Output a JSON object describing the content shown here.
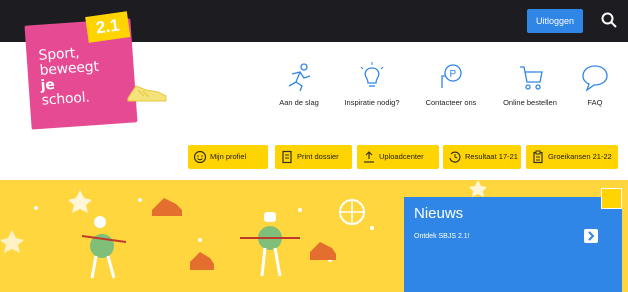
{
  "header": {
    "logout_label": "Uitloggen",
    "search_icon": "search-icon"
  },
  "logo": {
    "version": "2.1",
    "line1": "Sport,",
    "line2": "beweegt",
    "line3": "je",
    "line4": "school."
  },
  "nav": {
    "items": [
      {
        "label": "Aan de slag",
        "icon": "runner-icon"
      },
      {
        "label": "Inspiratie nodig?",
        "icon": "lightbulb-icon"
      },
      {
        "label": "Contacteer ons",
        "icon": "contact-icon"
      },
      {
        "label": "Online bestellen",
        "icon": "cart-icon"
      },
      {
        "label": "FAQ",
        "icon": "chat-icon"
      }
    ]
  },
  "actions": {
    "items": [
      {
        "label": "Mijn profiel",
        "icon": "smiley-icon"
      },
      {
        "label": "Print dossier",
        "icon": "document-icon"
      },
      {
        "label": "Uploadcenter",
        "icon": "upload-icon"
      },
      {
        "label": "Resultaat 17-21",
        "icon": "history-icon"
      },
      {
        "label": "Groeikansen 21-22",
        "icon": "clipboard-icon"
      }
    ]
  },
  "news": {
    "title": "Nieuws",
    "item": "Ontdek SBJS 2.1!"
  },
  "colors": {
    "topbar": "#1d1d21",
    "brand_pink": "#e64a93",
    "brand_yellow": "#ffd400",
    "accent_blue": "#2f86e6"
  }
}
